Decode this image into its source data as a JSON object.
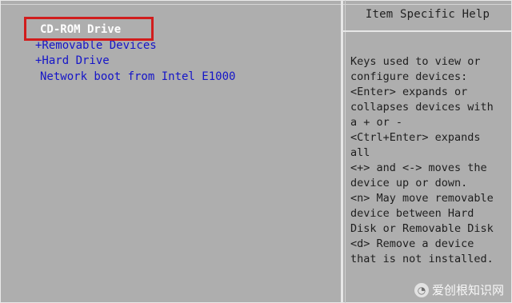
{
  "boot_menu": {
    "items": [
      {
        "label": "CD-ROM Drive",
        "selected": true
      },
      {
        "label": "+Removable Devices"
      },
      {
        "label": "+Hard Drive"
      },
      {
        "label": "Network boot from Intel E1000"
      }
    ]
  },
  "help_panel": {
    "title": "Item Specific Help",
    "lines": [
      "Keys used to view or",
      "configure devices:",
      "<Enter> expands or",
      "collapses devices with",
      "a + or -",
      "<Ctrl+Enter> expands",
      "all",
      "<+> and <-> moves the",
      "device up or down.",
      "<n> May move removable",
      "device between Hard",
      "Disk or Removable Disk",
      "<d> Remove a device",
      "that is not installed."
    ]
  },
  "watermark": {
    "text": "爱创根知识网"
  },
  "colors": {
    "background": "#aeaeae",
    "item_text": "#1515c8",
    "selected_text": "#ffffff",
    "highlight_border": "#d11d1d"
  }
}
